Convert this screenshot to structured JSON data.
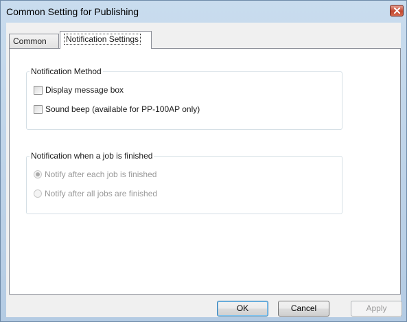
{
  "window": {
    "title": "Common Setting for Publishing"
  },
  "tabs": [
    {
      "label": "Common",
      "active": false
    },
    {
      "label": "Notification Settings",
      "active": true
    }
  ],
  "notification_method": {
    "legend": "Notification Method",
    "options": [
      {
        "label": "Display message box",
        "checked": false
      },
      {
        "label": "Sound beep (available for PP-100AP only)",
        "checked": false
      }
    ]
  },
  "notification_finish": {
    "legend": "Notification when a job is finished",
    "enabled": false,
    "options": [
      {
        "label": "Notify after each job is finished",
        "selected": true
      },
      {
        "label": "Notify after all jobs are finished",
        "selected": false
      }
    ]
  },
  "buttons": {
    "ok": "OK",
    "cancel": "Cancel",
    "apply": "Apply",
    "apply_enabled": false
  },
  "icons": {
    "close": "close-icon"
  }
}
